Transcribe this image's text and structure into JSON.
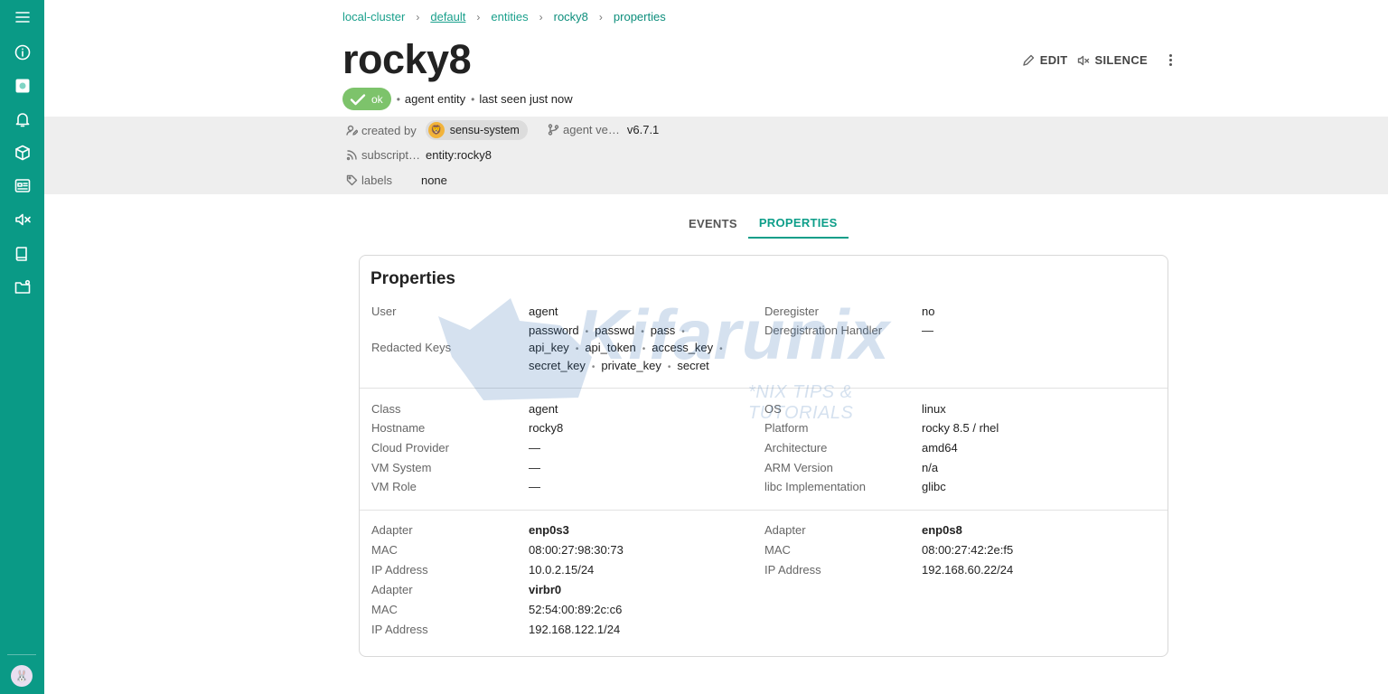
{
  "breadcrumb": [
    "local-cluster",
    "default",
    "entities",
    "rocky8",
    "properties"
  ],
  "entity": {
    "name": "rocky8",
    "status": "ok",
    "type": "agent entity",
    "last_seen": "last seen just now"
  },
  "actions": {
    "edit": "EDIT",
    "silence": "SILENCE"
  },
  "meta": {
    "created_by_label": "created by",
    "created_by": "sensu-system",
    "agent_version_label": "agent ve…",
    "agent_version": "v6.7.1",
    "subscriptions_label": "subscript…",
    "subscriptions": "entity:rocky8",
    "labels_label": "labels",
    "labels": "none"
  },
  "tabs": [
    "EVENTS",
    "PROPERTIES"
  ],
  "properties": {
    "title": "Properties",
    "user_label": "User",
    "user": "agent",
    "redacted_label": "Redacted Keys",
    "redacted_keys": [
      "password",
      "passwd",
      "pass",
      "api_key",
      "api_token",
      "access_key",
      "secret_key",
      "private_key",
      "secret"
    ],
    "deregister_label": "Deregister",
    "deregister": "no",
    "dereg_handler_label": "Deregistration Handler",
    "dereg_handler": "—",
    "system": {
      "class_label": "Class",
      "class": "agent",
      "hostname_label": "Hostname",
      "hostname": "rocky8",
      "cloud_label": "Cloud Provider",
      "cloud": "—",
      "vm_system_label": "VM System",
      "vm_system": "—",
      "vm_role_label": "VM Role",
      "vm_role": "—",
      "os_label": "OS",
      "os": "linux",
      "platform_label": "Platform",
      "platform": "rocky 8.5 / rhel",
      "arch_label": "Architecture",
      "arch": "amd64",
      "arm_label": "ARM Version",
      "arm": "n/a",
      "libc_label": "libc Implementation",
      "libc": "glibc"
    },
    "network": {
      "adapter_label": "Adapter",
      "mac_label": "MAC",
      "ip_label": "IP Address",
      "interfaces": [
        {
          "name": "enp0s3",
          "mac": "08:00:27:98:30:73",
          "ip": "10.0.2.15/24"
        },
        {
          "name": "enp0s8",
          "mac": "08:00:27:42:2e:f5",
          "ip": "192.168.60.22/24"
        },
        {
          "name": "virbr0",
          "mac": "52:54:00:89:2c:c6",
          "ip": "192.168.122.1/24"
        }
      ]
    }
  },
  "watermark": {
    "brand": "Kifarunix",
    "tagline": "*NIX TIPS & TUTORIALS"
  },
  "colors": {
    "sidebar": "#0a9a86",
    "accent": "#0d9e89",
    "ok": "#7dc36b"
  }
}
